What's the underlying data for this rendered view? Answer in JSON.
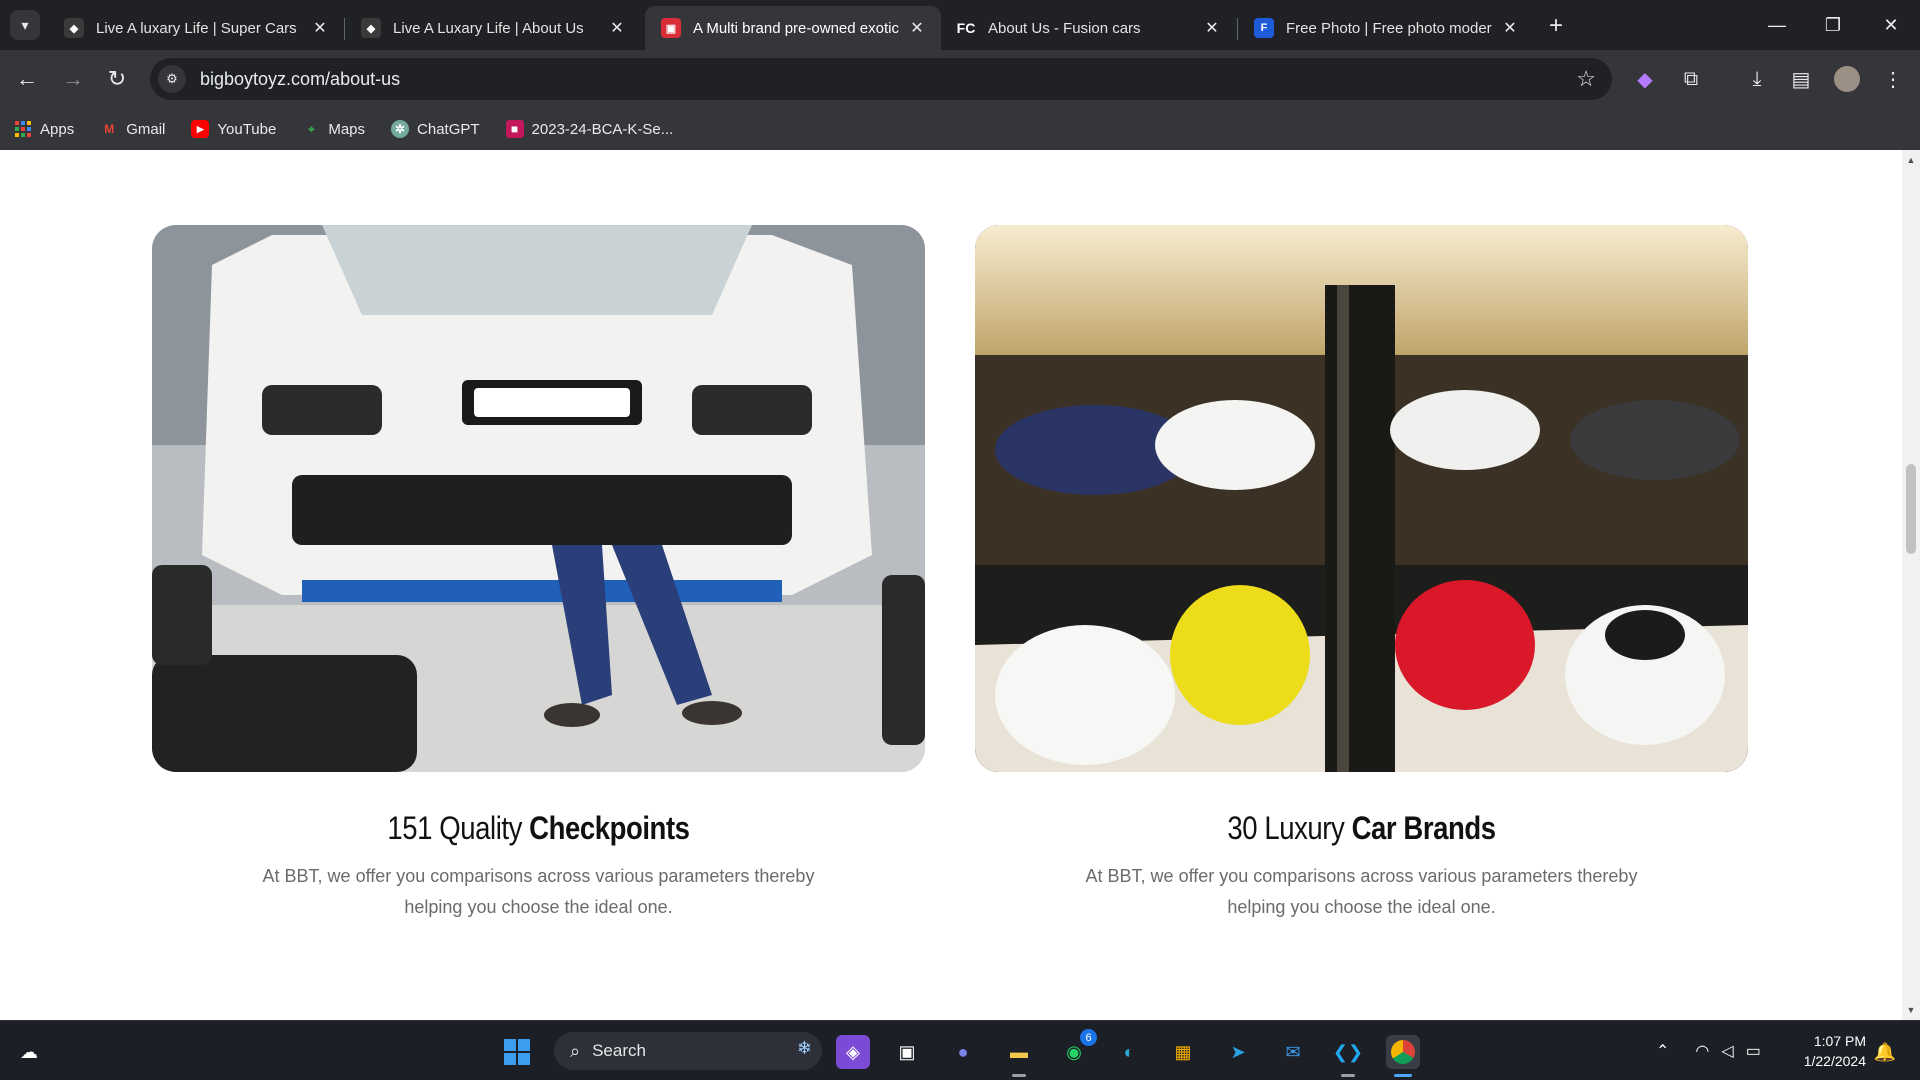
{
  "browser": {
    "tabs": [
      {
        "title": "Live A luxary Life | Super Cars",
        "favicon": "car-logo-icon",
        "active": false
      },
      {
        "title": "Live A Luxary Life | About Us",
        "favicon": "car-logo-icon",
        "active": false
      },
      {
        "title": "A Multi brand pre-owned exotic",
        "favicon": "bbt-car-icon",
        "active": true
      },
      {
        "title": "About Us - Fusion cars",
        "favicon": "fc-logo-icon",
        "active": false
      },
      {
        "title": "Free Photo | Free photo modern",
        "favicon": "freepik-icon",
        "active": false
      }
    ],
    "url": "bigboytoyz.com/about-us",
    "bookmarks": [
      {
        "label": "Apps",
        "icon": "apps-grid-icon"
      },
      {
        "label": "Gmail",
        "icon": "gmail-icon"
      },
      {
        "label": "YouTube",
        "icon": "youtube-icon"
      },
      {
        "label": "Maps",
        "icon": "maps-icon"
      },
      {
        "label": "ChatGPT",
        "icon": "chatgpt-icon"
      },
      {
        "label": "2023-24-BCA-K-Se...",
        "icon": "classroom-icon"
      }
    ]
  },
  "page": {
    "cards": [
      {
        "title_light": "151 Quality ",
        "title_bold": "Checkpoints",
        "description": "At BBT, we offer you comparisons across various parameters thereby helping you choose the ideal one."
      },
      {
        "title_light": "30 Luxury ",
        "title_bold": "Car Brands",
        "description": "At BBT, we offer you comparisons across various parameters thereby helping you choose the ideal one."
      }
    ]
  },
  "taskbar": {
    "search_label": "Search",
    "whatsapp_badge": "6",
    "time": "1:07 PM",
    "date": "1/22/2024"
  },
  "colors": {
    "tabstrip": "#202124",
    "toolbar": "#35363a",
    "title_text": "#111111",
    "description_text": "#6b6b6b",
    "taskbar": "#1c1f26"
  }
}
